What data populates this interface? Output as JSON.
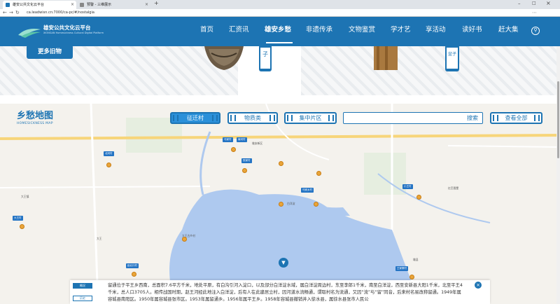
{
  "browser": {
    "tabs": [
      {
        "label": "雄安公共文化云平台",
        "active": true
      },
      {
        "label": "预警 - 三维展示",
        "active": false
      }
    ],
    "url": "ca.leadwisn.cn:7000/ca-pc/#/nostalgia",
    "nav_back": "←",
    "nav_forward": "→",
    "nav_reload": "↻"
  },
  "header": {
    "logo_title": "雄安公共文化云平台",
    "logo_subtitle": "XIONGAN Homesickness Cultural Digital Platform",
    "nav_items": [
      {
        "label": "首页",
        "active": false
      },
      {
        "label": "汇资讯",
        "active": false
      },
      {
        "label": "雄安乡愁",
        "active": true
      },
      {
        "label": "非遗传承",
        "active": false
      },
      {
        "label": "文物鉴赏",
        "active": false
      },
      {
        "label": "学才艺",
        "active": false
      },
      {
        "label": "享活动",
        "active": false
      },
      {
        "label": "读好书",
        "active": false
      },
      {
        "label": "赶大集",
        "active": false
      }
    ],
    "link_icon": "link-icon"
  },
  "hero": {
    "more_button": "更多旧物",
    "vertical_label_1": "子",
    "vertical_label_2": "盆子"
  },
  "map_section": {
    "title": "乡愁地图",
    "subtitle": "HOMESICKNESS MAP",
    "filters": [
      {
        "label": "征迁村",
        "active": true
      },
      {
        "label": "物质类",
        "active": false
      },
      {
        "label": "集中片区",
        "active": false
      }
    ],
    "search_placeholder": "",
    "search_button": "搜索",
    "view_all_button": "查看全部"
  },
  "map_labels": {
    "road_top": "雄安新区",
    "lake": "白洋淀",
    "town_center": "雄县",
    "right_label": "红匹围堡",
    "left_label": "大王",
    "left_label2": "大王镇",
    "bottom_left": "大王古乡村",
    "tag_1": "马家村",
    "tag_2": "南河村",
    "tag_3": "北河村",
    "tag_4": "张家村",
    "tag_5": "马家乡村",
    "tag_6": "小王村",
    "tag_7": "大王村",
    "tag_8": "赵北口村",
    "tag_9": "王家寨村"
  },
  "info_panel": {
    "side_btn_1": "概况",
    "side_btn_2": "历史",
    "text": "留通位于平王乡西南，总面积7.6平方千米，地处平原，有白沟引河入淀口，以及部分白洋淀水域，属白洋淀周边村，东至李郎1千米，南至白洋淀，西至安新县大阳1千米，北至平王4千米，总人口3705人。相传战国时期，赵王河经此地注入白洋淀，后有人在此建居立村，因河道水流畅通，谓取村名为流通，又因“流”与“留”同音，后来村名易改称留通。1949年属容城县南阳区。1950年属容城县张市区。1953年属留通乡。1956年属平王乡。1958年容城县撤销并入徐水县，属徐水县张市人民公"
  },
  "colors": {
    "brand_blue": "#1d74b3",
    "accent_blue": "#2b90d9",
    "poi_orange": "#e9a53a",
    "water": "#aec9ef"
  }
}
